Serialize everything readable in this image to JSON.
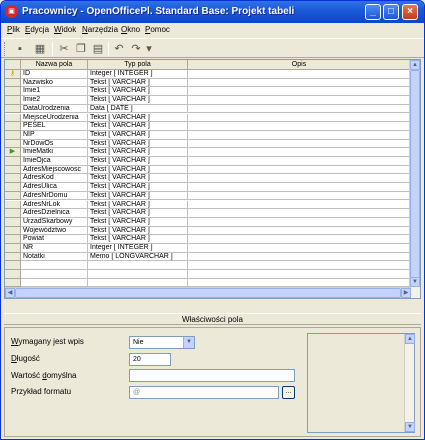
{
  "window": {
    "title": "Pracownicy - OpenOfficePl. Standard Base: Projekt tabeli",
    "app_icon": "openoffice-base-icon",
    "controls": {
      "minimize": "_",
      "maximize": "□",
      "close": "×"
    }
  },
  "menu": [
    {
      "u": "P",
      "rest": "lik"
    },
    {
      "u": "E",
      "rest": "dycja"
    },
    {
      "u": "W",
      "rest": "idok"
    },
    {
      "u": "N",
      "rest": "arzędzia"
    },
    {
      "u": "O",
      "rest": "kno"
    },
    {
      "u": "P",
      "rest": "omoc"
    }
  ],
  "toolbar": {
    "icons": [
      "save-icon",
      "table-icon",
      "cut-icon",
      "copy-icon",
      "paste-icon",
      "undo-icon",
      "redo-icon",
      "overflow-arrow-icon"
    ]
  },
  "grid": {
    "headers": {
      "name": "Nazwa pola",
      "type": "Typ pola",
      "desc": "Opis"
    },
    "rows": [
      {
        "marker": "key",
        "name": "ID",
        "type": "Integer [ INTEGER ]"
      },
      {
        "name": "Nazwisko",
        "type": "Tekst [ VARCHAR ]"
      },
      {
        "name": "Imie1",
        "type": "Tekst [ VARCHAR ]"
      },
      {
        "name": "Imie2",
        "type": "Tekst [ VARCHAR ]"
      },
      {
        "name": "DataUrodzenia",
        "type": "Data [ DATE ]"
      },
      {
        "name": "MiejsceUrodzenia",
        "type": "Tekst [ VARCHAR ]"
      },
      {
        "name": "PESEL",
        "type": "Tekst [ VARCHAR ]"
      },
      {
        "name": "NIP",
        "type": "Tekst [ VARCHAR ]"
      },
      {
        "name": "NrDowOs",
        "type": "Tekst [ VARCHAR ]"
      },
      {
        "marker": "current",
        "name": "ImieMatki",
        "type": "Tekst [ VARCHAR ]"
      },
      {
        "name": "ImieOjca",
        "type": "Tekst [ VARCHAR ]"
      },
      {
        "name": "AdresMiejscowosc",
        "type": "Tekst [ VARCHAR ]"
      },
      {
        "name": "AdresKod",
        "type": "Tekst [ VARCHAR ]"
      },
      {
        "name": "AdresUlica",
        "type": "Tekst [ VARCHAR ]"
      },
      {
        "name": "AdresNrDomu",
        "type": "Tekst [ VARCHAR ]"
      },
      {
        "name": "AdresNrLok",
        "type": "Tekst [ VARCHAR ]"
      },
      {
        "name": "AdresDzielnica",
        "type": "Tekst [ VARCHAR ]"
      },
      {
        "name": "UrzadSkarbowy",
        "type": "Tekst [ VARCHAR ]"
      },
      {
        "name": "Województwo",
        "type": "Tekst [ VARCHAR ]"
      },
      {
        "name": "Powiat",
        "type": "Tekst [ VARCHAR ]"
      },
      {
        "name": "NR",
        "type": "Integer [ INTEGER ]"
      },
      {
        "name": "Notatki",
        "type": "Memo [ LONGVARCHAR ]"
      },
      {
        "name": "",
        "type": ""
      },
      {
        "name": "",
        "type": ""
      },
      {
        "name": "",
        "type": ""
      }
    ]
  },
  "properties": {
    "header": "Właściwości pola",
    "required": {
      "u": "W",
      "rest": "ymagany jest wpis",
      "value": "Nie"
    },
    "length": {
      "u": "D",
      "rest": "ługość",
      "value": "20"
    },
    "default": {
      "pre": "Wartość ",
      "u": "d",
      "rest": "omyślna",
      "value": ""
    },
    "format": {
      "label": "Przykład formatu",
      "value": "@",
      "button": "..."
    }
  },
  "colors": {
    "title_bar": "#0b47c7",
    "face": "#ece9d8",
    "grid_line": "#c0c0c0"
  }
}
